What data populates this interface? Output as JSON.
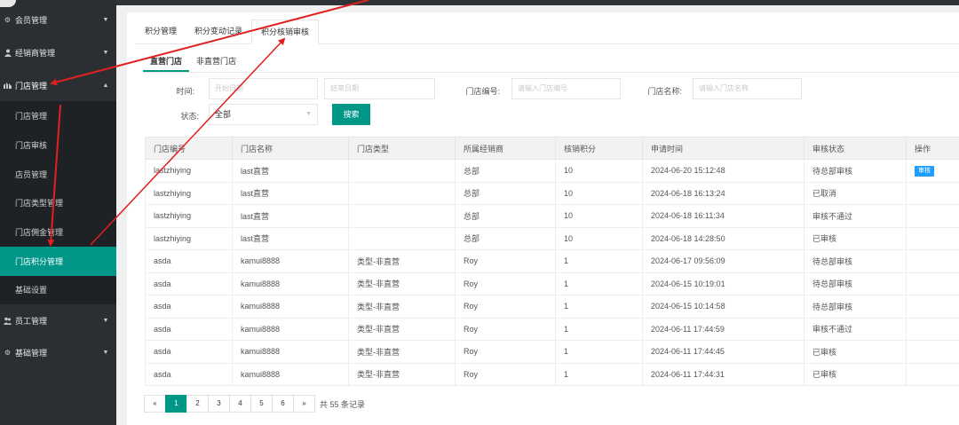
{
  "sidebar": {
    "items": [
      {
        "label": "会员管理",
        "icon": "gear-icon",
        "caret": "▼"
      },
      {
        "label": "经销商管理",
        "icon": "user-icon",
        "caret": "▼"
      },
      {
        "label": "门店管理",
        "icon": "store-icon",
        "caret": "▲"
      },
      {
        "label": "员工管理",
        "icon": "people-icon",
        "caret": "▼"
      },
      {
        "label": "基础管理",
        "icon": "gear-icon",
        "caret": "▼"
      }
    ],
    "sub_items": [
      {
        "label": "门店管理"
      },
      {
        "label": "门店审核"
      },
      {
        "label": "店员管理"
      },
      {
        "label": "门店类型管理"
      },
      {
        "label": "门店佣金管理"
      },
      {
        "label": "门店积分管理"
      },
      {
        "label": "基础设置"
      }
    ],
    "active_sub_index": 5
  },
  "tabs_top": [
    "积分管理",
    "积分变动记录",
    "积分核销审核"
  ],
  "tabs_sub": [
    "直营门店",
    "非直营门店"
  ],
  "filters": {
    "time_label": "时间:",
    "start_placeholder": "开始日期",
    "end_placeholder": "结束日期",
    "store_no_label": "门店编号:",
    "store_no_placeholder": "请输入门店编号",
    "store_name_label": "门店名称:",
    "store_name_placeholder": "请输入门店名称",
    "status_label": "状态:",
    "status_value": "全部",
    "search_label": "搜索"
  },
  "table": {
    "headers": [
      "门店编号",
      "门店名称",
      "门店类型",
      "所属经销商",
      "核销积分",
      "申请时间",
      "审核状态",
      "操作"
    ],
    "rows": [
      [
        "lastzhiying",
        "last直营",
        "",
        "总部",
        "10",
        "2024-06-20 15:12:48",
        "待总部审核",
        "审核"
      ],
      [
        "lastzhiying",
        "last直营",
        "",
        "总部",
        "10",
        "2024-06-18 16:13:24",
        "已取消",
        ""
      ],
      [
        "lastzhiying",
        "last直营",
        "",
        "总部",
        "10",
        "2024-06-18 16:11:34",
        "审核不通过",
        ""
      ],
      [
        "lastzhiying",
        "last直营",
        "",
        "总部",
        "10",
        "2024-06-18 14:28:50",
        "已审核",
        ""
      ],
      [
        "asda",
        "kamui8888",
        "类型-非直营",
        "Roy",
        "1",
        "2024-06-17 09:56:09",
        "待总部审核",
        ""
      ],
      [
        "asda",
        "kamui8888",
        "类型-非直营",
        "Roy",
        "1",
        "2024-06-15 10:19:01",
        "待总部审核",
        ""
      ],
      [
        "asda",
        "kamui8888",
        "类型-非直营",
        "Roy",
        "1",
        "2024-06-15 10:14:58",
        "待总部审核",
        ""
      ],
      [
        "asda",
        "kamui8888",
        "类型-非直营",
        "Roy",
        "1",
        "2024-06-11 17:44:59",
        "审核不通过",
        ""
      ],
      [
        "asda",
        "kamui8888",
        "类型-非直营",
        "Roy",
        "1",
        "2024-06-11 17:44:45",
        "已审核",
        ""
      ],
      [
        "asda",
        "kamui8888",
        "类型-非直营",
        "Roy",
        "1",
        "2024-06-11 17:44:31",
        "已审核",
        ""
      ]
    ]
  },
  "pager": {
    "prev": "«",
    "pages": [
      "1",
      "2",
      "3",
      "4",
      "5",
      "6"
    ],
    "current": "1",
    "next": "»",
    "total_text": "共 55 条记录"
  },
  "colors": {
    "accent": "#009688",
    "audit_button": "#1e9fff",
    "annotation_arrow": "#e02020",
    "sidebar_bg": "#2b2f33"
  }
}
